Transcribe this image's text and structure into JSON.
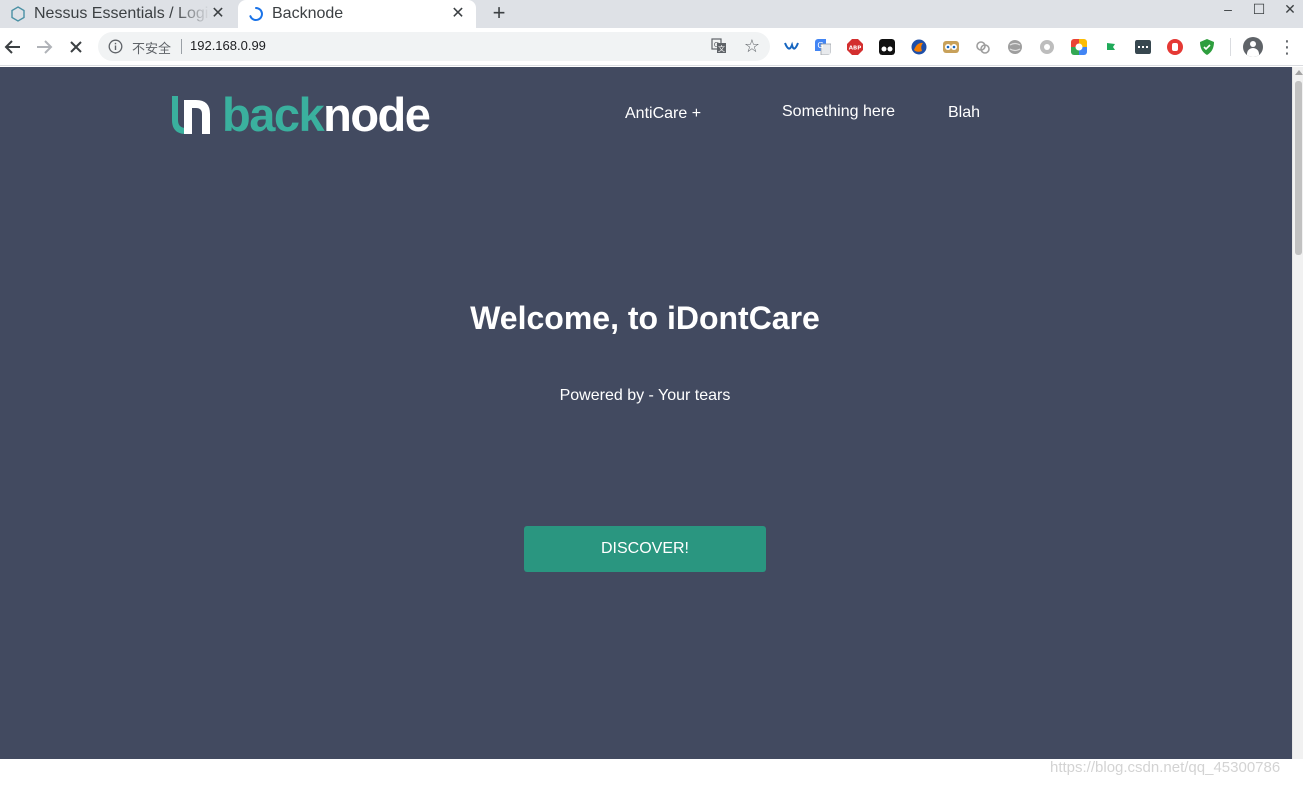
{
  "browser": {
    "tabs": [
      {
        "title": "Nessus Essentials / Login",
        "active": false,
        "icon": "nessus-hexagon-icon"
      },
      {
        "title": "Backnode",
        "active": true,
        "icon": "loading-spinner-icon"
      }
    ],
    "new_tab_symbol": "+",
    "window_controls": {
      "minimize": "–",
      "maximize": "☐",
      "close": "✕"
    },
    "tab_close_symbol": "✕",
    "address_bar": {
      "security_label": "不安全",
      "url": "192.168.0.99"
    },
    "bookmark_star": "☆",
    "menu_symbol": "⋮",
    "extensions": [
      "wp-wave-icon",
      "google-translate-icon",
      "adblock-plus-icon",
      "tampermonkey-icon",
      "firefox-like-icon",
      "owl-eyes-icon",
      "link-chain-icon",
      "globe-icon",
      "settings-gear-icon",
      "google-drive-color-icon",
      "green-flag-icon",
      "dark-terminal-icon",
      "red-hand-icon",
      "green-shield-icon"
    ]
  },
  "page": {
    "logo": {
      "part1": "back",
      "part2": "node"
    },
    "nav": {
      "item1": "AntiCare +",
      "item2": "Something here",
      "item3": "Blah"
    },
    "hero": {
      "title": "Welcome, to iDontCare",
      "subtitle": "Powered by - Your tears",
      "button": "DISCOVER!"
    },
    "colors": {
      "background": "#424a60",
      "accent": "#3ab09e",
      "button": "#2a9680"
    }
  },
  "watermark": "https://blog.csdn.net/qq_45300786"
}
